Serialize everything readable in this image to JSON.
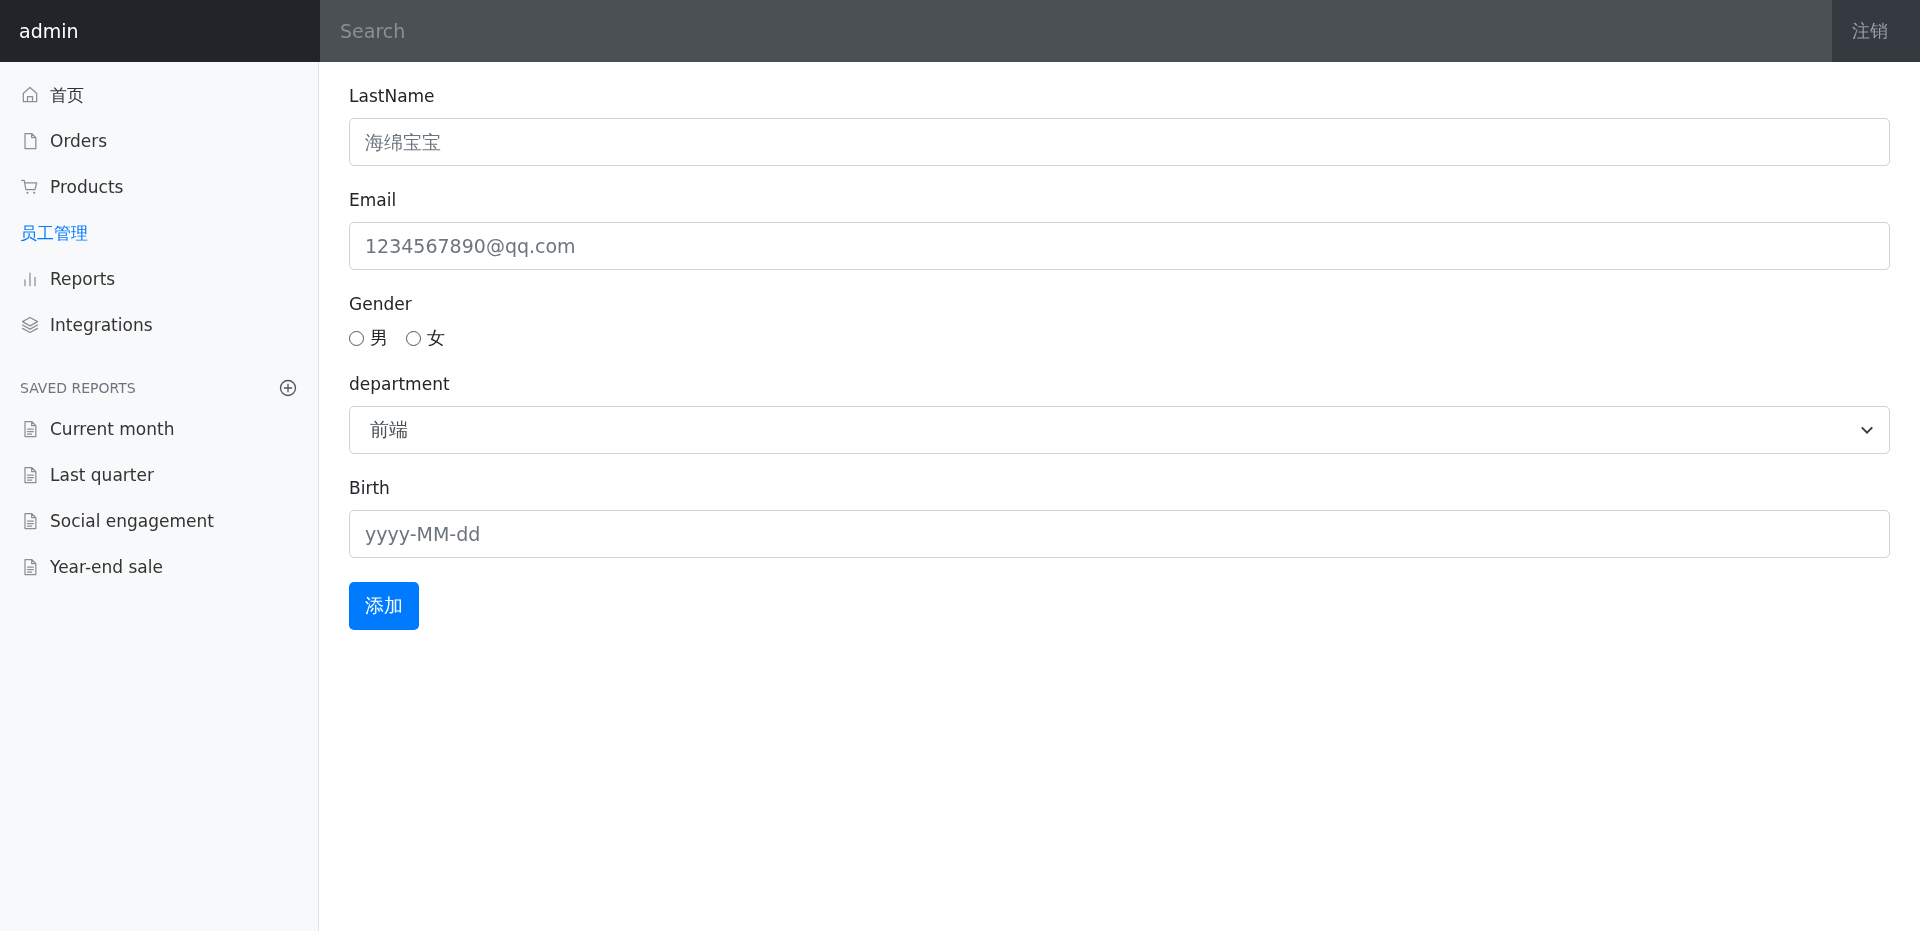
{
  "navbar": {
    "brand": "admin",
    "search": {
      "placeholder": "Search"
    },
    "signout": "注销"
  },
  "sidebar": {
    "items": [
      {
        "label": "首页",
        "kind": "home",
        "selected": false
      },
      {
        "label": "Orders",
        "kind": "file",
        "selected": false
      },
      {
        "label": "Products",
        "kind": "cart",
        "selected": false
      },
      {
        "label": "员工管理",
        "kind": "plain",
        "selected": true
      },
      {
        "label": "Reports",
        "kind": "bars",
        "selected": false
      },
      {
        "label": "Integrations",
        "kind": "layers",
        "selected": false
      }
    ],
    "saved_reports": {
      "heading": "SAVED REPORTS",
      "items": [
        {
          "label": "Current month",
          "selected": false
        },
        {
          "label": "Last quarter",
          "selected": false
        },
        {
          "label": "Social engagement",
          "selected": false
        },
        {
          "label": "Year-end sale",
          "selected": false
        }
      ]
    }
  },
  "form": {
    "fields": [
      {
        "kind": "text",
        "label": "LastName",
        "placeholder": "海绵宝宝"
      },
      {
        "kind": "text",
        "label": "Email",
        "placeholder": "1234567890@qq.com"
      },
      {
        "kind": "radio",
        "label": "Gender",
        "options": [
          {
            "label": "男",
            "selected": false
          },
          {
            "label": "女",
            "selected": false
          }
        ]
      },
      {
        "kind": "select",
        "label": "department",
        "value": "前端"
      },
      {
        "kind": "text",
        "label": "Birth",
        "placeholder": "yyyy-MM-dd"
      }
    ],
    "submit": "添加"
  }
}
